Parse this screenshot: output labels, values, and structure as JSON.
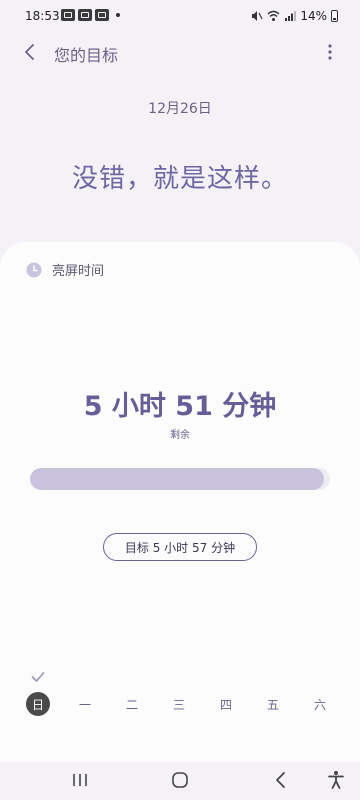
{
  "status_bar": {
    "time": "18:53",
    "battery": "14%",
    "notification_icons": [
      "gallery-icon",
      "gallery-icon",
      "gallery-icon"
    ]
  },
  "app_bar": {
    "title": "您的目标"
  },
  "date": "12月26日",
  "headline": "没错，就是这样。",
  "card": {
    "title": "亮屏时间",
    "remaining_time": "5 小时 51 分钟",
    "remaining_label": "剩余",
    "progress_fraction": 0.98,
    "goal_button": "目标 5 小时 57 分钟"
  },
  "weekdays": [
    {
      "label": "日",
      "active": true
    },
    {
      "label": "一",
      "active": false
    },
    {
      "label": "二",
      "active": false
    },
    {
      "label": "三",
      "active": false
    },
    {
      "label": "四",
      "active": false
    },
    {
      "label": "五",
      "active": false
    },
    {
      "label": "六",
      "active": false
    }
  ],
  "colors": {
    "accent": "#6f66a3",
    "progress": "#c9c3de",
    "background": "#f4f2f7",
    "card": "#fcfcfd"
  }
}
